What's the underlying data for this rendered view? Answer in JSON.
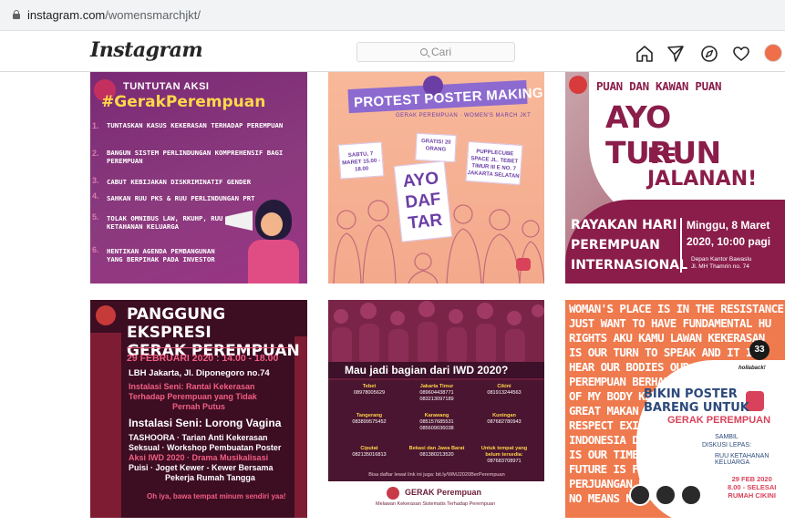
{
  "browser": {
    "url_host": "instagram.com",
    "url_path": "/womensmarchjkt/"
  },
  "header": {
    "logo": "Instagram",
    "search_placeholder": "Cari",
    "icons": [
      "home-icon",
      "direct-message-icon",
      "explore-icon",
      "activity-heart-icon",
      "profile-avatar"
    ]
  },
  "posts": [
    {
      "heading_small": "TUNTUTAN AKSI",
      "heading_big": "#GerakPerempuan",
      "items": [
        "TUNTASKAN KASUS KEKERASAN TERHADAP PEREMPUAN",
        "BANGUN SISTEM PERLINDUNGAN KOMPREHENSIF BAGI PEREMPUAN",
        "CABUT KEBIJAKAN DISKRIMINATIF GENDER",
        "SAHKAN RUU PKS & RUU PERLINDUNGAN PRT",
        "TOLAK OMNIBUS LAW, RKUHP, RUU KETAHANAN KELUARGA",
        "HENTIKAN AGENDA PEMBANGUNAN YANG BERPIHAK PADA INVESTOR"
      ],
      "numbers": [
        "1.",
        "2.",
        "3.",
        "4.",
        "5.",
        "6."
      ]
    },
    {
      "title": "PROTEST POSTER MAKING",
      "subtitle": "GERAK PEREMPUAN · WOMEN'S MARCH JKT",
      "sign_date": "SABTU, 7 MARET 15.00 - 18.00",
      "sign_free": "GRATIS! 20 ORANG",
      "sign_place": "PUPPLECUBE SPACE JL. TEBET TIMUR III E NO. 7 JAKARTA SELATAN",
      "cta": "AYO DAF TAR"
    },
    {
      "line1": "PUAN DAN KAWAN PUAN",
      "line2": "AYO TURUN",
      "line3": "KE JALANAN!",
      "left1": "RAYAKAN HARI",
      "left2": "PEREMPUAN",
      "left3": "INTERNASIONAL",
      "date": "Minggu, 8 Maret",
      "time": "2020, 10:00 pagi",
      "place1": "Depan Kantor Bawaslu",
      "place2": "Jl. MH Thamrin no. 74"
    },
    {
      "title1": "PANGGUNG EKSPRESI",
      "title2": "GERAK PEREMPUAN",
      "date": "29 FEBRUARI 2020 : 14.00 - 18.00",
      "venue": "LBH Jakarta, Jl. Diponegoro no.74",
      "inst1a": "Instalasi Seni: Rantai Kekerasan",
      "inst1b": "Terhadap Perempuan yang Tidak",
      "inst1c": "Pernah Putus",
      "inst2": "Instalasi Seni: Lorong Vagina",
      "p1": "TASHOORA · Tarian Anti Kekerasan",
      "p2": "Seksual · Workshop Pembuatan Poster",
      "p3": "Aksi IWD 2020 · Drama Musikalisasi",
      "p4": "Puisi · Joget Kewer - Kewer Bersama",
      "p5": "Pekerja Rumah Tangga",
      "note": "Oh iya, bawa tempat minum sendiri yaa!"
    },
    {
      "question": "Mau jadi bagian dari IWD 2020?",
      "contacts": [
        {
          "area": "Tebet",
          "phone": "08978005629"
        },
        {
          "area": "Jakarta Timur",
          "phone": "089604438771 083213097189"
        },
        {
          "area": "Cikini",
          "phone": "081913244563"
        },
        {
          "area": "Tangerang",
          "phone": "083899575452"
        },
        {
          "area": "Karawang",
          "phone": "085157685531 085609036038"
        },
        {
          "area": "Kuningan",
          "phone": "087682780943"
        },
        {
          "area": "Ciputat",
          "phone": "082135016813"
        },
        {
          "area": "Bekasi dan Jawa Barat",
          "phone": "081380213520"
        },
        {
          "area": "Untuk tempat yang belum tersedia:",
          "phone": "087683708971"
        }
      ],
      "form_note": "Bisa daftar lewat link ini juga: bit.ly/WMJ2020BerPerempuan",
      "org": "GERAK Perempuan",
      "tagline": "Melawan Kekerasan Sistematis Terhadap Perempuan"
    },
    {
      "scribble": [
        "WOMAN'S PLACE IS IN THE RESISTANCE",
        "JUST WANT TO HAVE FUNDAMENTAL HU",
        "RIGHTS AKU KAMU LAWAN KEKERASAN",
        "IS OUR TURN TO SPEAK AND IT IS",
        "HEAR OUR BODIES OUR MAN",
        "PEREMPUAN BERHAK",
        "OF MY BODY KEKERASAN",
        "GREAT MAKAN ENAK",
        "RESPECT EXISTENCE",
        "INDONESIA DARURAT",
        "IS OUR TIME",
        "FUTURE IS FEMALE",
        "PERJUANGAN PEREMPUAN",
        "NO MEANS NO"
      ],
      "logo_num": "33",
      "logo_brand": "hollaback!",
      "headline1": "BIKIN POSTER",
      "headline2": "BARENG UNTUK",
      "headline3": "GERAK PEREMPUAN",
      "sub1": "SAMBIL",
      "sub2": "DISKUSI LEPAS:",
      "sub3": "RUU KETAHANAN KELUARGA",
      "date1": "29 FEB 2020",
      "date2": "8.00 - SELESAI",
      "date3": "RUMAH CIKINI"
    }
  ]
}
